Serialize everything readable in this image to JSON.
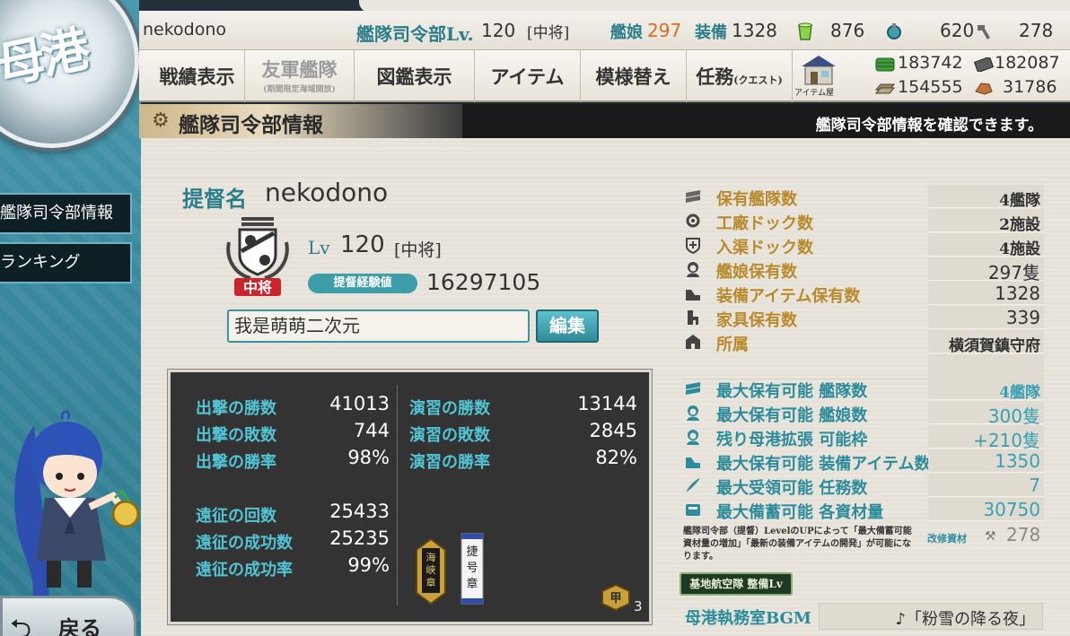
{
  "app": {
    "port_label": "母港"
  },
  "sidebar": {
    "items": [
      {
        "label": "艦隊司令部情報"
      },
      {
        "label": "ランキング"
      }
    ],
    "back_label": "戻る"
  },
  "header": {
    "player_name": "nekodono",
    "hq_label": "艦隊司令部Lv.",
    "hq_level": "120",
    "rank": "[中将]",
    "ships_label": "艦娘",
    "ships_count": "297",
    "equip_label": "装備",
    "equip_count": "1328",
    "bucket": "876",
    "devmat": "620",
    "screws": "278"
  },
  "menu": {
    "items": [
      {
        "label": "戦績表示"
      },
      {
        "label": "友軍艦隊",
        "sub": "(期間限定海域開放)"
      },
      {
        "label": "図鑑表示"
      },
      {
        "label": "アイテム"
      },
      {
        "label": "模様替え"
      },
      {
        "label": "任務",
        "sub": "(クエスト)"
      }
    ],
    "shop_label": "アイテム屋"
  },
  "resources": {
    "fuel": "183742",
    "ammo": "182087",
    "steel": "154555",
    "bauxite": "31786"
  },
  "section": {
    "title": "艦隊司令部情報",
    "description": "艦隊司令部情報を確認できます。"
  },
  "admiral": {
    "name_label": "提督名",
    "name": "nekodono",
    "rank_badge": "中将",
    "lv_label": "Lv",
    "level": "120",
    "rank": "[中将]",
    "exp_label": "提督経験値",
    "exp": "16297105",
    "comment": "我是萌萌二次元",
    "edit_label": "編集"
  },
  "stats": {
    "sortie_wins_label": "出撃の勝数",
    "sortie_wins": "41013",
    "sortie_losses_label": "出撃の敗数",
    "sortie_losses": "744",
    "sortie_rate_label": "出撃の勝率",
    "sortie_rate": "98%",
    "exercise_wins_label": "演習の勝数",
    "exercise_wins": "13144",
    "exercise_losses_label": "演習の敗数",
    "exercise_losses": "2845",
    "exercise_rate_label": "演習の勝率",
    "exercise_rate": "82%",
    "expedition_count_label": "遠征の回数",
    "expedition_count": "25433",
    "expedition_success_label": "遠征の成功数",
    "expedition_success": "25235",
    "expedition_rate_label": "遠征の成功率",
    "expedition_rate": "99%",
    "medal1_text": "海峡章",
    "medal2_text": "捷号章",
    "medal3_text": "甲",
    "medal3_count": "3"
  },
  "info": {
    "rows": [
      {
        "label": "保有艦隊数",
        "value": "4艦隊",
        "icon": "fleet-icon"
      },
      {
        "label": "工廠ドック数",
        "value": "2施設",
        "icon": "gear-icon"
      },
      {
        "label": "入渠ドック数",
        "value": "4施設",
        "icon": "repair-icon"
      },
      {
        "label": "艦娘保有数",
        "value": "297隻",
        "icon": "shipgirl-icon"
      },
      {
        "label": "装備アイテム保有数",
        "value": "1328",
        "icon": "equipment-icon"
      },
      {
        "label": "家具保有数",
        "value": "339",
        "icon": "furniture-icon"
      },
      {
        "label": "所属",
        "value": "横須賀鎮守府",
        "icon": "flag-icon"
      }
    ],
    "max_rows": [
      {
        "label": "最大保有可能 艦隊数",
        "value": "4艦隊",
        "icon": "fleet-icon"
      },
      {
        "label": "最大保有可能 艦娘数",
        "value": "300隻",
        "icon": "shipgirl-icon"
      },
      {
        "label": "残り母港拡張 可能枠",
        "value": "+210隻",
        "icon": "shipgirl-icon"
      },
      {
        "label": "最大保有可能 装備アイテム数",
        "value": "1350",
        "icon": "equipment-icon"
      },
      {
        "label": "最大受領可能 任務数",
        "value": "7",
        "icon": "quill-icon"
      },
      {
        "label": "最大備蓄可能 各資材量",
        "value": "30750",
        "icon": "storage-icon"
      }
    ],
    "note": "艦隊司令部（提督）LevelのUPによって「最大備蓄可能資材量の増加」「最新の装備アイテムの開発」が可能になります。",
    "improvement_label": "改修資材",
    "improvement_value": "278",
    "base_button": "基地航空隊 整備Lv",
    "bgm_label": "母港執務室BGM",
    "bgm_value": "♪「粉雪の降る夜」"
  },
  "colors": {
    "accent_teal": "#2c8c9c",
    "label_gold": "#b98a2b",
    "dark_panel": "#333333",
    "ships_orange": "#d66d1f"
  }
}
